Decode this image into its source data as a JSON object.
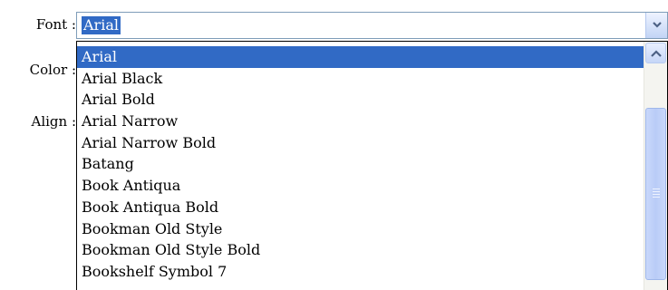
{
  "labels": {
    "font": "Font :",
    "color": "Color :",
    "align": "Align :"
  },
  "font_select": {
    "value": "Arial",
    "arrow_icon": "chevron-down-icon"
  },
  "font_options": [
    "Arial",
    "Arial Black",
    "Arial Bold",
    "Arial Narrow",
    "Arial Narrow Bold",
    "Batang",
    "Book Antiqua",
    "Book Antiqua Bold",
    "Bookman Old Style",
    "Bookman Old Style Bold",
    "Bookshelf Symbol 7"
  ],
  "selected_index": 0,
  "colors": {
    "highlight": "#316ac5",
    "border": "#7f9db9"
  }
}
